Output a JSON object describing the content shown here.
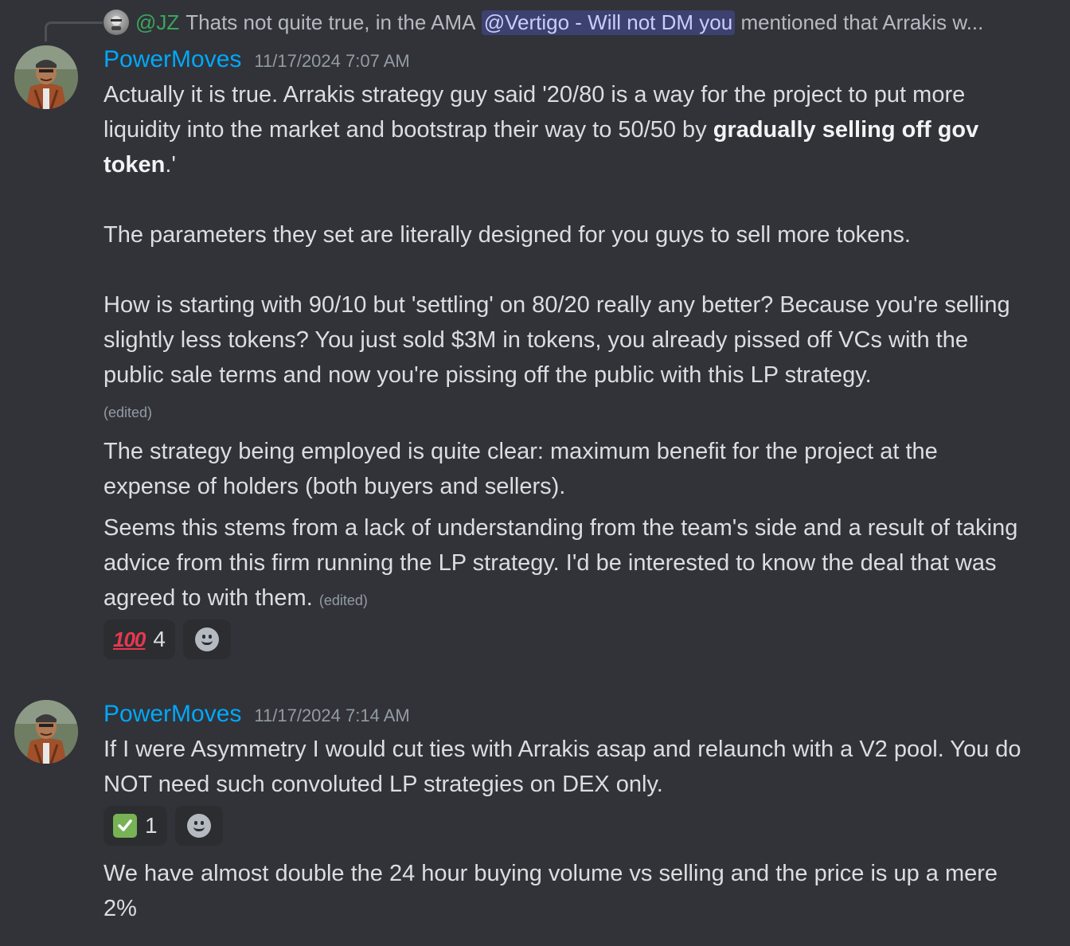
{
  "reply": {
    "author": "@JZ",
    "text_before": "Thats not quite true, in the AMA",
    "mention": "@Vertigo - Will not DM you",
    "text_after": "mentioned that Arrakis w..."
  },
  "messages": [
    {
      "username": "PowerMoves",
      "timestamp": "11/17/2024 7:07 AM",
      "p1_a": "Actually it is true. Arrakis strategy guy said '20/80 is a way for the project to put more liquidity into the market and bootstrap their way to 50/50 by ",
      "p1_bold": "gradually selling off gov token",
      "p1_b": ".'",
      "p2": "The parameters they set are literally designed for you guys to sell more tokens.",
      "p3": "How is starting with 90/10 but 'settling' on 80/20 really any better? Because you're selling slightly less tokens? You just sold $3M in tokens, you already pissed off VCs with the public sale terms and now you're pissing off the public with this LP strategy.",
      "edited1": "(edited)",
      "p4": "The strategy being employed is quite clear: maximum benefit for the project at the expense of holders (both buyers and sellers).",
      "p5": "Seems this stems from a lack of understanding from the team's side and a result of taking advice from this firm running the LP strategy. I'd be interested to know the deal that was agreed to with them.",
      "edited2": "(edited)",
      "reaction": {
        "emoji": "💯",
        "count": "4"
      }
    },
    {
      "username": "PowerMoves",
      "timestamp": "11/17/2024 7:14 AM",
      "p1": "If I were Asymmetry I would cut ties with Arrakis asap and relaunch with a V2 pool. You do NOT need such convoluted LP strategies on DEX only.",
      "reaction": {
        "emoji": "✅",
        "count": "1"
      },
      "p2": "We have almost double the 24 hour buying volume vs selling and the price is up a mere 2%"
    }
  ]
}
